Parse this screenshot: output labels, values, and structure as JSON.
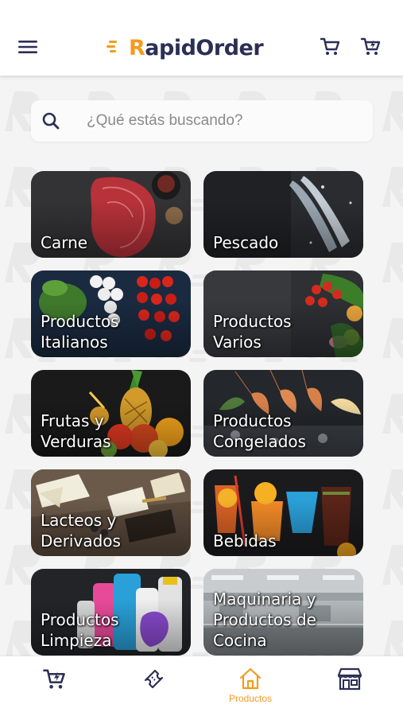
{
  "header": {
    "logo_prefix": "R",
    "logo_rest": "apidOrder"
  },
  "search": {
    "placeholder": "¿Qué estás buscando?"
  },
  "categories": [
    {
      "label": "Carne"
    },
    {
      "label": "Pescado"
    },
    {
      "label": "Productos\nItalianos"
    },
    {
      "label": "Productos\nVarios"
    },
    {
      "label": "Frutas y\nVerduras"
    },
    {
      "label": "Productos\nCongelados"
    },
    {
      "label": "Lacteos y\nDerivados"
    },
    {
      "label": "Bebidas"
    },
    {
      "label": "Productos\nLimpieza"
    },
    {
      "label": "Maquinaria y\nProductos de\nCocina"
    }
  ],
  "bottom_nav": {
    "active": "Productos",
    "products_label": "Productos"
  },
  "colors": {
    "brand_dark": "#2b2f55",
    "brand_orange": "#f39a1f"
  }
}
